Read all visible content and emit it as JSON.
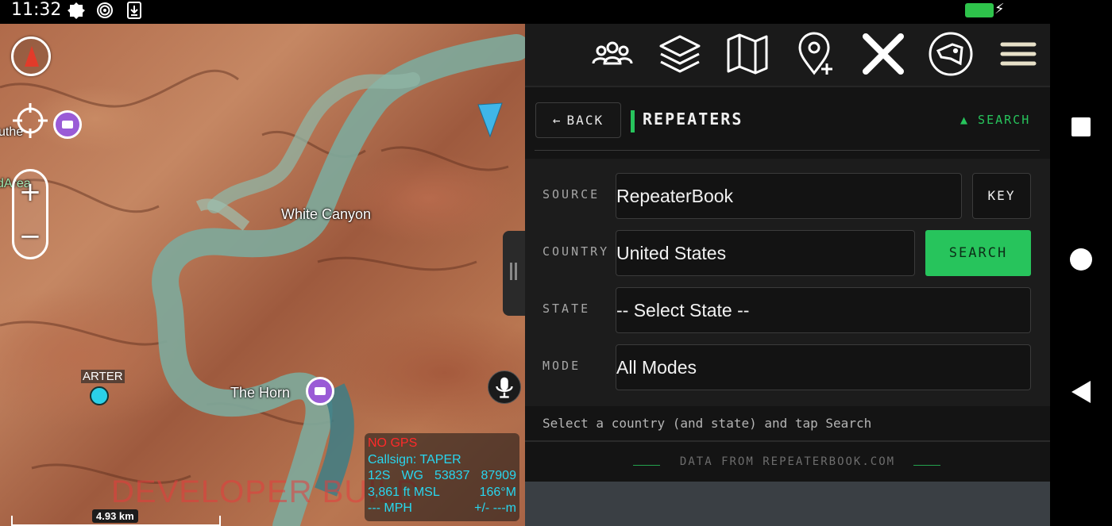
{
  "status_bar": {
    "time": "11:32",
    "battery_color": "#2ec34b"
  },
  "map": {
    "labels": {
      "white_canyon": "White Canyon",
      "the_horn": "The Horn",
      "left_edge_1": "uthe",
      "left_edge_2": "dArea"
    },
    "user_marker_label": "ARTER",
    "developer_watermark": "DEVELOPER BUILD",
    "scale": "4.93 km",
    "gps": {
      "status": "NO GPS",
      "callsign": "Callsign: TAPER",
      "grid_zone": "12S",
      "grid_square": "WG",
      "easting": "53837",
      "northing": "87909",
      "altitude": "3,861 ft MSL",
      "heading": "166°M",
      "speed": "--- MPH",
      "accuracy": "+/- ---m"
    },
    "zoom_in_symbol": "+",
    "zoom_out_symbol": "−",
    "colors": {
      "water": "#7fa89a",
      "user_dot": "#2bd1e8",
      "compass_arrow": "#e23b2a",
      "nav_arrow": "#3fb6e8",
      "camera_marker": "#9a5bd6"
    }
  },
  "toolbar": {
    "icons": [
      "users-icon",
      "layers-icon",
      "map-icon",
      "add-location-icon",
      "close-icon",
      "dog-icon",
      "menu-icon"
    ]
  },
  "panel": {
    "back_label": "BACK",
    "back_arrow": "←",
    "title": "REPEATERS",
    "search_toggle": "▲  SEARCH",
    "accent_color": "#27c45c",
    "form": {
      "source_label": "SOURCE",
      "source_value": "RepeaterBook",
      "key_label": "KEY",
      "country_label": "COUNTRY",
      "country_value": "United States",
      "search_label": "SEARCH",
      "state_label": "STATE",
      "state_value": "-- Select State --",
      "mode_label": "MODE",
      "mode_value": "All Modes"
    },
    "hint": "Select a country (and state) and tap Search",
    "footer_credit": "DATA FROM REPEATERBOOK.COM"
  }
}
